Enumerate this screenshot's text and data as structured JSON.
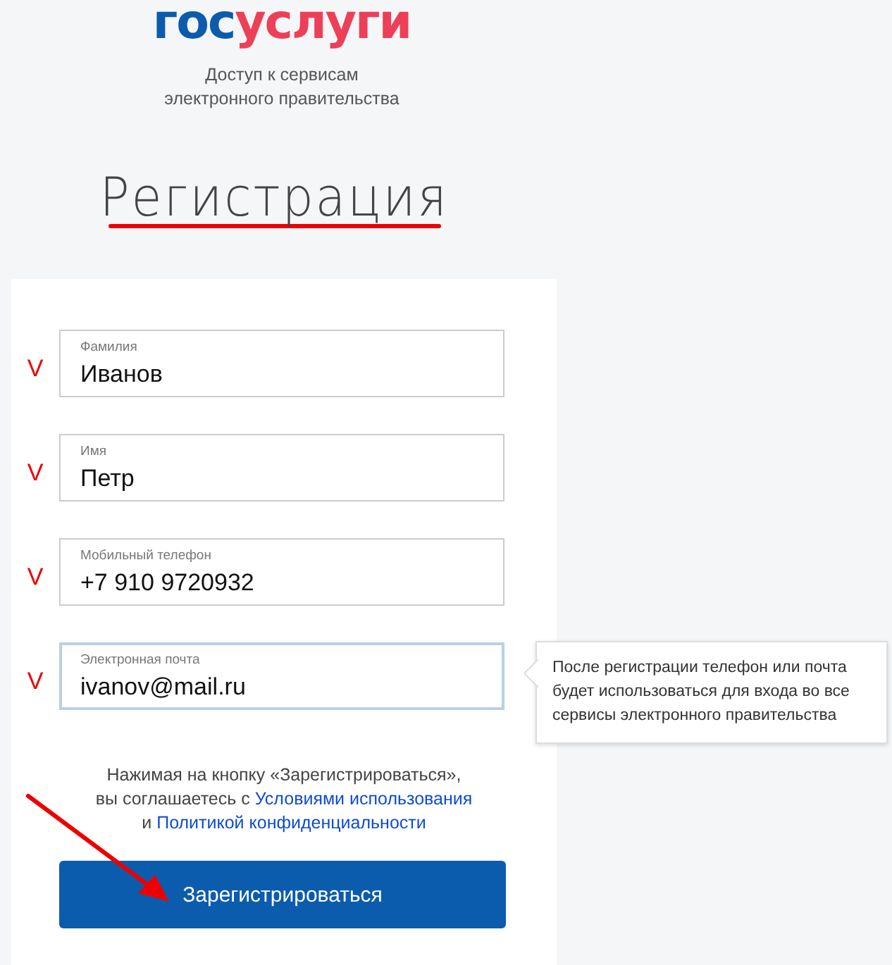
{
  "logo": {
    "part_1": "гос",
    "part_2": "услуги"
  },
  "tagline": [
    "Доступ к сервисам",
    "электронного правительства"
  ],
  "title": "Регистрация",
  "fields": [
    {
      "label": "Фамилия",
      "value": "Иванов",
      "focused": false,
      "mark": "V"
    },
    {
      "label": "Имя",
      "value": "Петр",
      "focused": false,
      "mark": "V"
    },
    {
      "label": "Мобильный телефон",
      "value": "+7 910 9720932",
      "focused": false,
      "mark": "V"
    },
    {
      "label": "Электронная почта",
      "value": "ivanov@mail.ru",
      "focused": true,
      "mark": "V"
    }
  ],
  "tooltip": "После регистрации телефон или почта будет использоваться для входа во все сервисы электронного правительства",
  "agreement": [
    [
      {
        "text": "Нажимая на кнопку «Зарегистрироваться»,",
        "link": false
      }
    ],
    [
      {
        "text": "вы соглашаетесь с ",
        "link": false
      },
      {
        "text": "Условиями использования",
        "link": true
      }
    ],
    [
      {
        "text": "и ",
        "link": false
      },
      {
        "text": "Политикой конфиденциальности",
        "link": true
      }
    ]
  ],
  "register_button": "Зарегистрироваться"
}
